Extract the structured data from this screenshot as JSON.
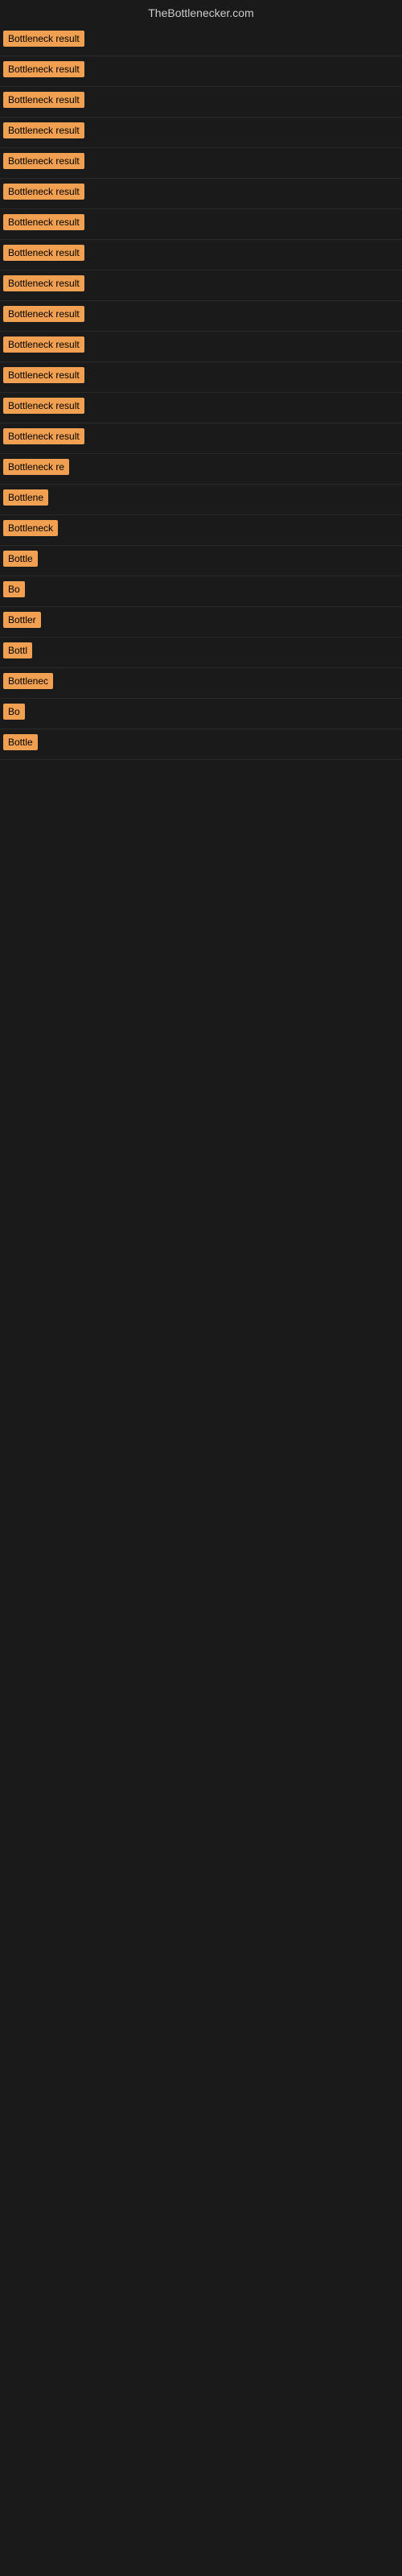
{
  "site": {
    "title": "TheBottlenecker.com"
  },
  "results": [
    {
      "label": "Bottleneck result",
      "width": 120
    },
    {
      "label": "Bottleneck result",
      "width": 120
    },
    {
      "label": "Bottleneck result",
      "width": 120
    },
    {
      "label": "Bottleneck result",
      "width": 120
    },
    {
      "label": "Bottleneck result",
      "width": 120
    },
    {
      "label": "Bottleneck result",
      "width": 120
    },
    {
      "label": "Bottleneck result",
      "width": 120
    },
    {
      "label": "Bottleneck result",
      "width": 120
    },
    {
      "label": "Bottleneck result",
      "width": 120
    },
    {
      "label": "Bottleneck result",
      "width": 120
    },
    {
      "label": "Bottleneck result",
      "width": 120
    },
    {
      "label": "Bottleneck result",
      "width": 110
    },
    {
      "label": "Bottleneck result",
      "width": 110
    },
    {
      "label": "Bottleneck result",
      "width": 110
    },
    {
      "label": "Bottleneck re",
      "width": 90
    },
    {
      "label": "Bottlene",
      "width": 75
    },
    {
      "label": "Bottleneck",
      "width": 80
    },
    {
      "label": "Bottle",
      "width": 60
    },
    {
      "label": "Bo",
      "width": 28
    },
    {
      "label": "Bottler",
      "width": 58
    },
    {
      "label": "Bottl",
      "width": 48
    },
    {
      "label": "Bottlenec",
      "width": 72
    },
    {
      "label": "Bo",
      "width": 28
    },
    {
      "label": "Bottle",
      "width": 55
    }
  ]
}
